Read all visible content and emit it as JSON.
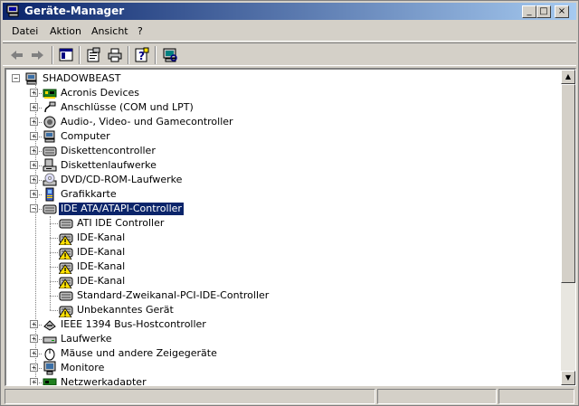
{
  "window": {
    "title": "Geräte-Manager",
    "controls": {
      "minimize": "_",
      "maximize": "□",
      "close": "×"
    }
  },
  "menubar": {
    "items": [
      {
        "label": "Datei"
      },
      {
        "label": "Aktion"
      },
      {
        "label": "Ansicht"
      },
      {
        "label": "?"
      }
    ]
  },
  "toolbar": {
    "buttons": [
      {
        "icon": "back-arrow-icon"
      },
      {
        "icon": "forward-arrow-icon"
      },
      {
        "icon": "show-hide-console-tree-icon"
      },
      {
        "icon": "properties-icon"
      },
      {
        "icon": "print-icon"
      },
      {
        "icon": "help-icon"
      },
      {
        "icon": "scan-hardware-icon"
      }
    ]
  },
  "tree": {
    "root": {
      "label": "SHADOWBEAST",
      "icon": "computer-icon",
      "expanded": true
    },
    "categories": [
      {
        "label": "Acronis Devices",
        "icon": "board-icon",
        "expanded": false
      },
      {
        "label": "Anschlüsse (COM und LPT)",
        "icon": "port-icon",
        "expanded": false
      },
      {
        "label": "Audio-, Video- und Gamecontroller",
        "icon": "speaker-icon",
        "expanded": false
      },
      {
        "label": "Computer",
        "icon": "computer-icon",
        "expanded": false
      },
      {
        "label": "Diskettencontroller",
        "icon": "controller-icon",
        "expanded": false
      },
      {
        "label": "Diskettenlaufwerke",
        "icon": "floppy-icon",
        "expanded": false
      },
      {
        "label": "DVD/CD-ROM-Laufwerke",
        "icon": "cdrom-icon",
        "expanded": false
      },
      {
        "label": "Grafikkarte",
        "icon": "display-adapter-icon",
        "expanded": false
      },
      {
        "label": "IDE ATA/ATAPI-Controller",
        "icon": "controller-icon",
        "expanded": true,
        "selected": true,
        "children": [
          {
            "label": "ATI IDE Controller",
            "icon": "controller-icon",
            "warning": false
          },
          {
            "label": "IDE-Kanal",
            "icon": "controller-icon",
            "warning": true
          },
          {
            "label": "IDE-Kanal",
            "icon": "controller-icon",
            "warning": true
          },
          {
            "label": "IDE-Kanal",
            "icon": "controller-icon",
            "warning": true
          },
          {
            "label": "IDE-Kanal",
            "icon": "controller-icon",
            "warning": true
          },
          {
            "label": "Standard-Zweikanal-PCI-IDE-Controller",
            "icon": "controller-icon",
            "warning": false
          },
          {
            "label": "Unbekanntes Gerät",
            "icon": "controller-icon",
            "warning": true
          }
        ]
      },
      {
        "label": "IEEE 1394 Bus-Hostcontroller",
        "icon": "firewire-icon",
        "expanded": false
      },
      {
        "label": "Laufwerke",
        "icon": "drive-icon",
        "expanded": false
      },
      {
        "label": "Mäuse und andere Zeigegeräte",
        "icon": "mouse-icon",
        "expanded": false
      },
      {
        "label": "Monitore",
        "icon": "monitor-icon",
        "expanded": false
      },
      {
        "label": "Netzwerkadapter",
        "icon": "network-card-icon",
        "expanded": false
      }
    ]
  },
  "colors": {
    "selection": "#0a246a",
    "titlebar_start": "#0a246a",
    "titlebar_end": "#a6caf0",
    "face": "#d4d0c8",
    "warning": "#ffe000"
  }
}
